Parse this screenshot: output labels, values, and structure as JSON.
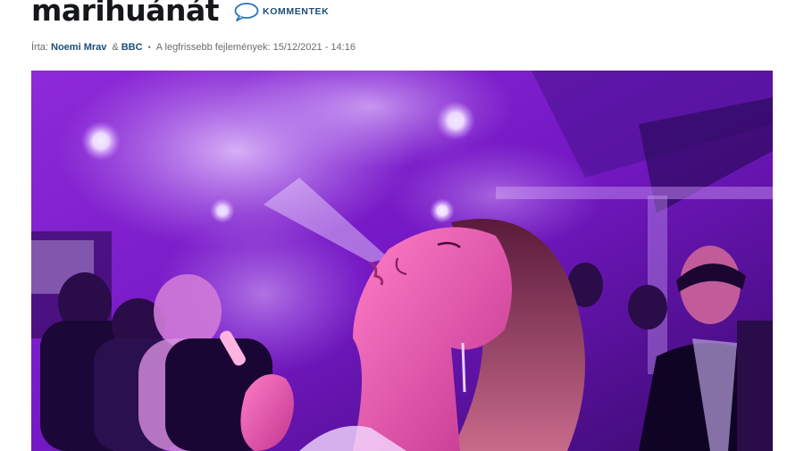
{
  "article": {
    "headline": "marihuánát",
    "comments_label": "KOMMENTEK",
    "byline": {
      "prefix": "Írta:",
      "author": "Noemi Mrav",
      "amp": "&",
      "source": "BBC",
      "separator": "•",
      "updated_label": "A legfrissebb fejlemények:",
      "updated_value": "15/12/2021 - 14:16"
    },
    "image": {
      "icon": "photo-smoking-party"
    }
  },
  "colors": {
    "headline": "#15171a",
    "link": "#1c4e7a",
    "meta": "#6b6b6b",
    "photo_tint": "#8a2be2"
  }
}
